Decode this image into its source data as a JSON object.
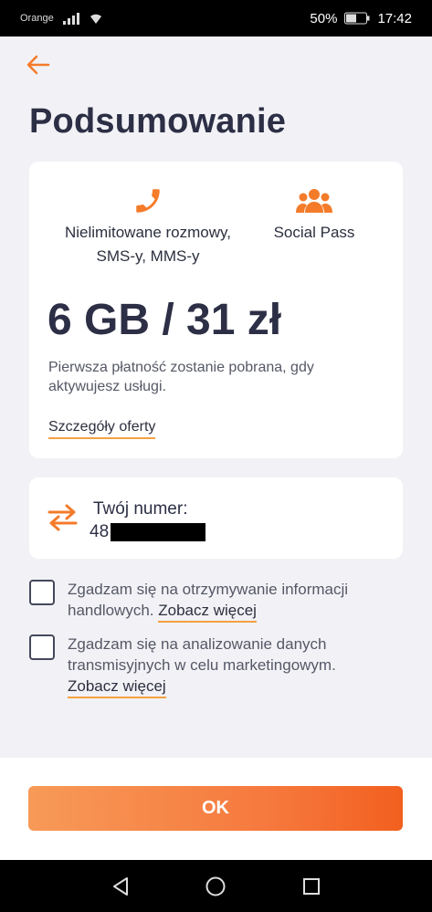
{
  "status_bar": {
    "carrier": "Orange",
    "battery": "50%",
    "time": "17:42"
  },
  "header": {
    "title": "Podsumowanie"
  },
  "offer": {
    "features": [
      {
        "icon": "phone-icon",
        "label": "Nielimitowane rozmowy, SMS-y, MMS-y"
      },
      {
        "icon": "users-icon",
        "label": "Social Pass"
      }
    ],
    "price": "6 GB / 31 zł",
    "payment_note": "Pierwsza płatność zostanie pobrana, gdy aktywujesz usługi.",
    "details_link": "Szczegóły oferty"
  },
  "number": {
    "icon": "swap-arrows-icon",
    "label": "Twój numer:",
    "prefix": "48"
  },
  "consents": [
    {
      "text": "Zgadzam się na otrzymywanie informacji handlowych.",
      "link": "Zobacz więcej",
      "checked": false
    },
    {
      "text": "Zgadzam się na analizowanie danych transmisyjnych w celu marketingowym.",
      "link": "Zobacz więcej",
      "checked": false
    }
  ],
  "footer": {
    "ok_label": "OK"
  },
  "colors": {
    "accent": "#f47b2a",
    "title": "#2c2f45",
    "underline": "#f5a142"
  }
}
